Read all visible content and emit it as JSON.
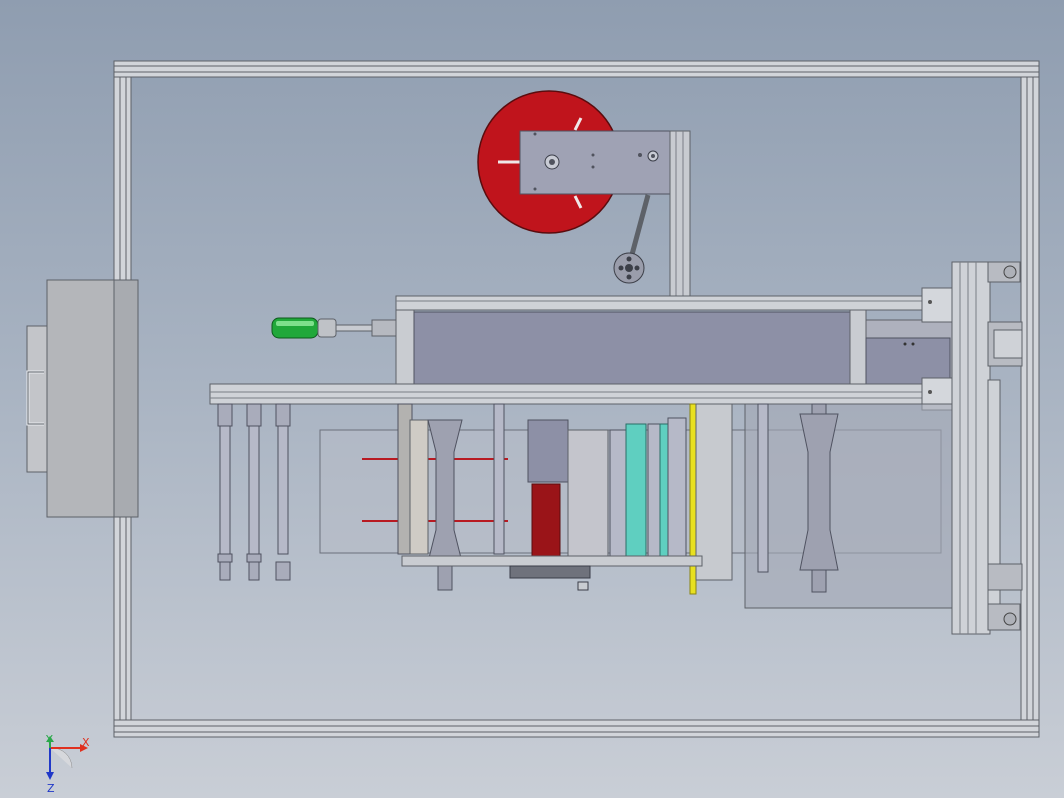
{
  "triad": {
    "x_label": "X",
    "y_label": "Y",
    "z_label": "Z",
    "x_color": "#e0301e",
    "y_color": "#2aa84a",
    "z_color": "#2038c8"
  },
  "colors": {
    "frame": "#c9ccd1",
    "frame_edge": "#6a6e76",
    "panel": "#8d90a6",
    "reel": "#c0141c",
    "handle_grip": "#20a83a",
    "cyan_roller": "#5fcfc0",
    "yellow_strip": "#e8e020",
    "red_block": "#9a1418"
  },
  "icons": [
    "triad-axis-icon"
  ]
}
